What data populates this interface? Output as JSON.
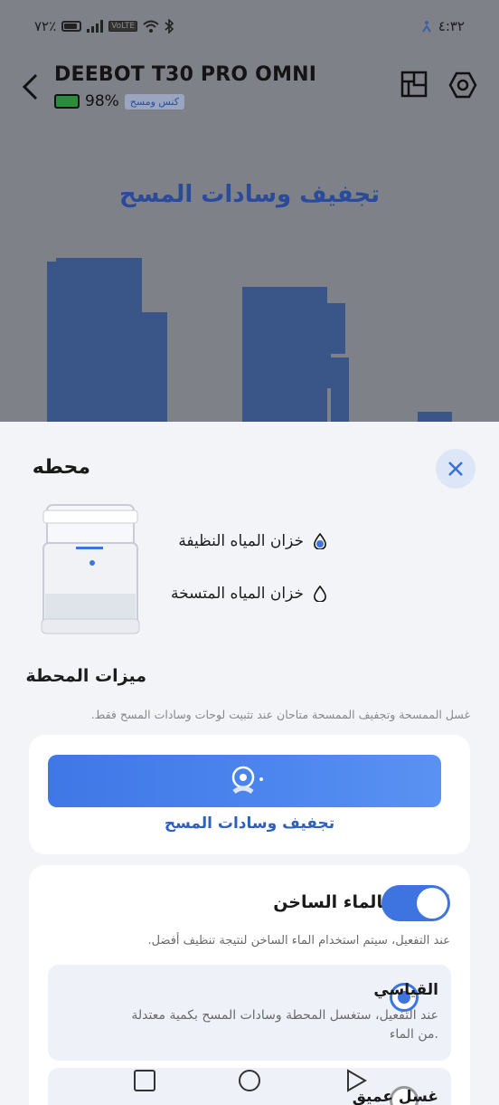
{
  "status_bar": {
    "battery_text": "٧٢٪",
    "volte": "VoLTE",
    "time": "٤:٣٢"
  },
  "header": {
    "title": "DEEBOT T30 PRO OMNI",
    "battery_pct": "98%",
    "mode_badge": "كنس ومسح"
  },
  "map": {
    "title": "تجفيف وسادات المسح"
  },
  "sheet": {
    "title": "محطه",
    "clean_tank": "خزان المياه النظيفة",
    "dirty_tank": "خزان المياه المتسخة",
    "features_title": "ميزات المحطة",
    "features_note": ".غسل الممسحة وتجفيف الممسحة متاحان عند تثبيت لوحات وسادات المسح فقط",
    "dry_label": "تجفيف وسادات المسح",
    "hot_wash_title": "الغسل بالماء الساخن",
    "hot_wash_note": ".عند التفعيل، سيتم استخدام الماء الساخن لنتيجة تنظيف أفضل",
    "hot_wash_on": true,
    "options": [
      {
        "title": "القياسي",
        "desc": "عند التفعيل، ستغسل المحطة وسادات المسح بكمية معتدلة من الماء.",
        "selected": true
      },
      {
        "title": "غسل عميق",
        "desc": "",
        "selected": false
      }
    ]
  },
  "colors": {
    "accent": "#3d74e0",
    "sheet_bg": "#f3f4f8",
    "map_block": "#3a5587"
  }
}
